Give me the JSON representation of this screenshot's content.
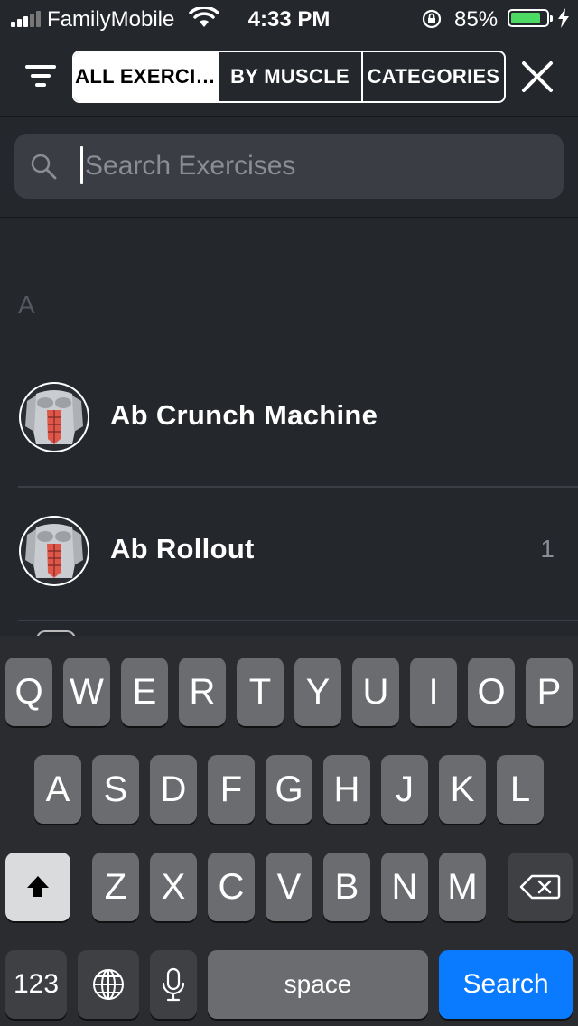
{
  "status_bar": {
    "carrier": "FamilyMobile",
    "time": "4:33 PM",
    "battery_percent": "85%",
    "battery_level": 0.85,
    "icons": [
      "signal-icon",
      "wifi-icon",
      "orientation-lock-icon",
      "battery-icon",
      "charging-icon"
    ]
  },
  "topbar": {
    "tabs": [
      {
        "label": "ALL EXERCI…",
        "selected": true
      },
      {
        "label": "BY MUSCLE",
        "selected": false
      },
      {
        "label": "CATEGORIES",
        "selected": false
      }
    ],
    "icons": {
      "filter": "filter-icon",
      "close": "close-icon"
    }
  },
  "search": {
    "placeholder": "Search Exercises",
    "value": "",
    "icon": "search-icon"
  },
  "list": {
    "section": "A",
    "items": [
      {
        "name": "Ab Crunch Machine",
        "count": "",
        "icon": "abs-muscle-icon"
      },
      {
        "name": "Ab Rollout",
        "count": "1",
        "icon": "abs-muscle-icon"
      }
    ]
  },
  "keyboard": {
    "row1": [
      "Q",
      "W",
      "E",
      "R",
      "T",
      "Y",
      "U",
      "I",
      "O",
      "P"
    ],
    "row2": [
      "A",
      "S",
      "D",
      "F",
      "G",
      "H",
      "J",
      "K",
      "L"
    ],
    "row3": [
      "Z",
      "X",
      "C",
      "V",
      "B",
      "N",
      "M"
    ],
    "numbers_label": "123",
    "space_label": "space",
    "search_label": "Search",
    "icons": {
      "shift": "shift-icon",
      "delete": "backspace-icon",
      "globe": "globe-icon",
      "mic": "microphone-icon"
    }
  },
  "colors": {
    "background": "#24272c",
    "search_field": "#3a3d43",
    "key": "#6b6c70",
    "search_key": "#0a7aff",
    "battery": "#4cd964",
    "muscle_highlight": "#e0574a"
  }
}
